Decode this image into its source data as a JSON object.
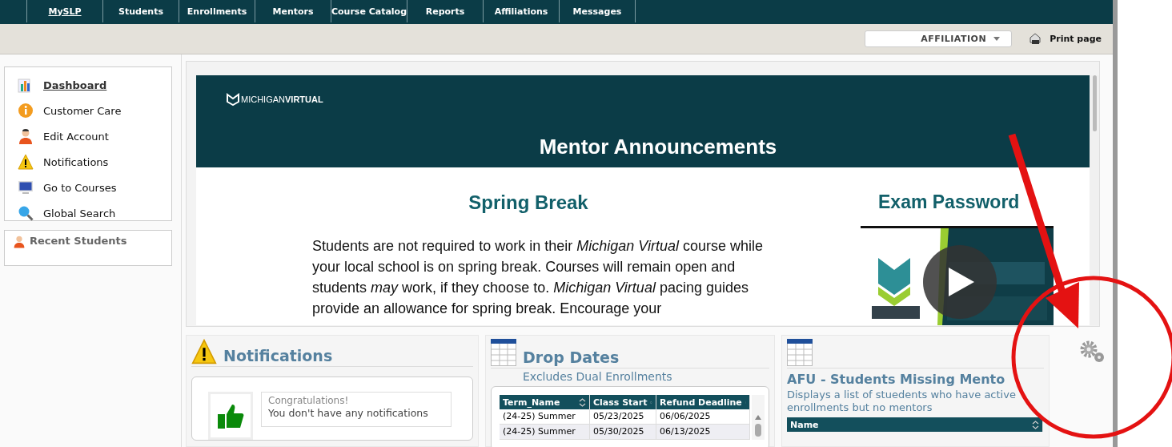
{
  "nav": {
    "tabs": [
      {
        "label": "MySLP",
        "selected": true
      },
      {
        "label": "Students",
        "selected": false
      },
      {
        "label": "Enrollments",
        "selected": false
      },
      {
        "label": "Mentors",
        "selected": false
      },
      {
        "label": "Course Catalog",
        "selected": false
      },
      {
        "label": "Reports",
        "selected": false
      },
      {
        "label": "Affiliations",
        "selected": false
      },
      {
        "label": "Messages",
        "selected": false
      }
    ]
  },
  "toolbar": {
    "affiliation": "AFFILIATION",
    "print": "Print page"
  },
  "sidebar": {
    "items": [
      {
        "label": "Dashboard",
        "selected": true
      },
      {
        "label": "Customer Care",
        "selected": false
      },
      {
        "label": "Edit Account",
        "selected": false
      },
      {
        "label": "Notifications",
        "selected": false
      },
      {
        "label": "Go to Courses",
        "selected": false
      },
      {
        "label": "Global Search",
        "selected": false
      }
    ],
    "recent_students": "Recent Students"
  },
  "announcements": {
    "logo": "MICHIGAN**VIRTUAL**",
    "title": "Mentor Announcements",
    "left": {
      "heading": "Spring Break",
      "body": "Students are not required to work in their *Michigan Virtual* course while your local school is on spring break.  Courses will remain open and students *may* work, if they choose to. *Michigan Virtual* pacing guides provide an allowance for spring break.  Encourage your"
    },
    "right": {
      "heading": "Exam Password"
    }
  },
  "notifications": {
    "title": "Notifications",
    "message_title": "Congratulations!",
    "message": "You don't have any notifications"
  },
  "drop_dates": {
    "title": "Drop Dates",
    "subtitle": "Excludes Dual Enrollments",
    "columns": [
      "Term_Name",
      "Class Start",
      "Refund Deadline"
    ],
    "rows": [
      [
        "(24-25) Summer",
        "05/23/2025",
        "06/06/2025"
      ],
      [
        "(24-25) Summer",
        "05/30/2025",
        "06/13/2025"
      ]
    ]
  },
  "afu": {
    "title": "AFU - Students Missing Mento",
    "description": "Displays a list of stuedents who have active enrollments but no mentors",
    "columns": [
      "Name"
    ]
  }
}
